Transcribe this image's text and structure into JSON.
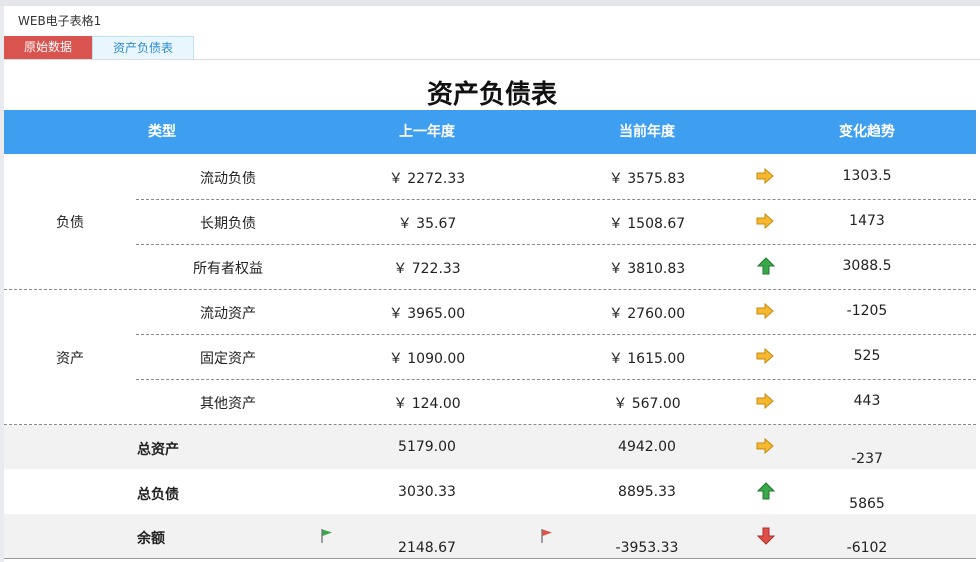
{
  "window": {
    "title": "WEB电子表格1"
  },
  "tabs": [
    {
      "label": "原始数据"
    },
    {
      "label": "资产负债表"
    }
  ],
  "report": {
    "title": "资产负债表",
    "headers": {
      "type": "类型",
      "prev_year": "上一年度",
      "curr_year": "当前年度",
      "trend": "变化趋势"
    },
    "groups": {
      "liability": "负债",
      "asset": "资产"
    },
    "rows": [
      {
        "name": "流动负债",
        "prev": "￥ 2272.33",
        "curr": "￥ 3575.83",
        "trend_icon": "right-arrow-icon",
        "change": "1303.5"
      },
      {
        "name": "长期负债",
        "prev": "￥ 35.67",
        "curr": "￥ 1508.67",
        "trend_icon": "right-arrow-icon",
        "change": "1473"
      },
      {
        "name": "所有者权益",
        "prev": "￥ 722.33",
        "curr": "￥ 3810.83",
        "trend_icon": "up-arrow-icon",
        "change": "3088.5"
      },
      {
        "name": "流动资产",
        "prev": "￥ 3965.00",
        "curr": "￥ 2760.00",
        "trend_icon": "right-arrow-icon",
        "change": "-1205"
      },
      {
        "name": "固定资产",
        "prev": "￥ 1090.00",
        "curr": "￥ 1615.00",
        "trend_icon": "right-arrow-icon",
        "change": "525"
      },
      {
        "name": "其他资产",
        "prev": "￥ 124.00",
        "curr": "￥ 567.00",
        "trend_icon": "right-arrow-icon",
        "change": "443"
      }
    ],
    "summary": [
      {
        "name": "总资产",
        "prev": "5179.00",
        "curr": "4942.00",
        "trend_icon": "right-arrow-icon",
        "change": "-237"
      },
      {
        "name": "总负债",
        "prev": "3030.33",
        "curr": "8895.33",
        "trend_icon": "up-arrow-icon",
        "change": "5865"
      },
      {
        "name": "余额",
        "prev": "2148.67",
        "curr": "-3953.33",
        "trend_icon": "down-arrow-icon",
        "change": "-6102",
        "prev_flag": "green-flag-icon",
        "curr_flag": "red-flag-icon"
      }
    ]
  },
  "colors": {
    "header_bg": "#3e9ef0",
    "tab_active": "#d9534f",
    "arrow_right": "#f5b82e",
    "arrow_up": "#3aa74a",
    "arrow_down": "#e0504b"
  }
}
